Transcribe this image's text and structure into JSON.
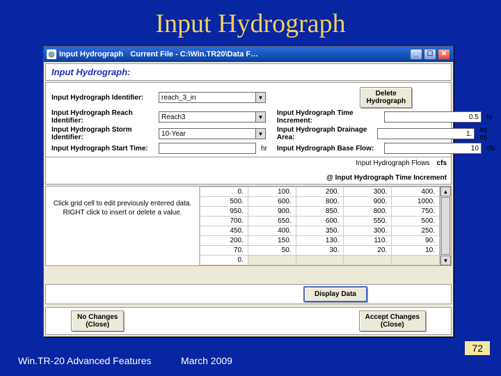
{
  "slide": {
    "title": "Input Hydrograph"
  },
  "titlebar": {
    "app": "Input Hydrograph",
    "currentFileLabel": "Current File  -  C:\\Win.TR20\\Data F…"
  },
  "panel": {
    "heading": "Input Hydrograph:"
  },
  "buttons": {
    "delete": "Delete\nHydrograph",
    "display": "Display Data",
    "noChanges": "No Changes\n(Close)",
    "accept": "Accept Changes\n(Close)"
  },
  "left": {
    "idLabel": "Input Hydrograph Identifier:",
    "idValue": "reach_3_in",
    "reachLabel": "Input Hydrograph Reach Identifier:",
    "reachValue": "Reach3",
    "stormLabel": "Input Hydrograph Storm Identifier:",
    "stormValue": "10-Year",
    "startLabel": "Input Hydrograph Start Time:",
    "startValue": "",
    "startUnit": "hr"
  },
  "right": {
    "incLabel": "Input Hydrograph Time Increment:",
    "incValue": "0.5",
    "incUnit": "hr",
    "areaLabel": "Input Hydrograph Drainage Area:",
    "areaValue": "1.",
    "areaUnit": "sq mi",
    "baseLabel": "Input Hydrograph Base Flow:",
    "baseValue": "10",
    "baseUnit": "cfs"
  },
  "flowHeader": {
    "label": "Input Hydrograph Flows",
    "unit": "cfs",
    "sub": "@ Input Hydrograph Time Increment"
  },
  "hint": "Click grid cell to edit previously entered data.\nRIGHT click to insert or delete  a value.",
  "gridData": [
    [
      "0.",
      "100.",
      "200.",
      "300.",
      "400."
    ],
    [
      "500.",
      "600.",
      "800.",
      "900.",
      "1000."
    ],
    [
      "950.",
      "900.",
      "850.",
      "800.",
      "750."
    ],
    [
      "700.",
      "650.",
      "600.",
      "550.",
      "500."
    ],
    [
      "450.",
      "400.",
      "350.",
      "300.",
      "250."
    ],
    [
      "200.",
      "150.",
      "130.",
      "110.",
      "90."
    ],
    [
      "70.",
      "50.",
      "30.",
      "20.",
      "10."
    ],
    [
      "0.",
      "",
      "",
      "",
      ""
    ]
  ],
  "footer": {
    "left": "Win.TR-20 Advanced Features",
    "mid": "March 2009",
    "page": "72"
  }
}
